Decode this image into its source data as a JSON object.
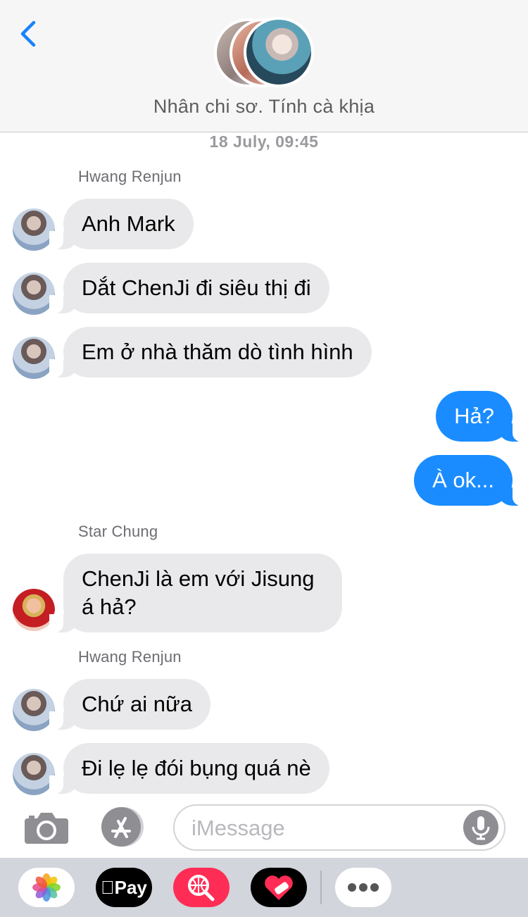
{
  "header": {
    "back_icon": "chevron-left-icon",
    "group_title": "Nhân chi sơ. Tính cà khịa"
  },
  "timestamp": "18 July, 09:45",
  "messages": [
    {
      "sender": "Hwang Renjun",
      "text": "Anh Mark",
      "side": "in"
    },
    {
      "text": "Dắt ChenJi đi siêu thị đi",
      "side": "in"
    },
    {
      "text": "Em ở nhà thăm dò tình hình",
      "side": "in"
    },
    {
      "text": "Hả?",
      "side": "out"
    },
    {
      "text": "À ok...",
      "side": "out"
    },
    {
      "sender": "Star Chung",
      "text": "ChenJi là em với Jisung á hả?",
      "side": "in"
    },
    {
      "sender": "Hwang Renjun",
      "text": "Chứ ai nữa",
      "side": "in"
    },
    {
      "text": "Đi lẹ lẹ đói bụng quá nè",
      "side": "in"
    }
  ],
  "input": {
    "placeholder": "iMessage",
    "value": ""
  },
  "apps": {
    "apple_pay_label": "Pay",
    "icons": [
      "camera-icon",
      "app-store-icon",
      "microphone-icon",
      "photos-icon",
      "apple-pay-icon",
      "image-search-icon",
      "stickers-icon",
      "more-icon"
    ]
  },
  "colors": {
    "outgoing_bubble": "#1a8cff",
    "incoming_bubble": "#e9e9eb",
    "accent": "#1a82fb",
    "search_app": "#ff2d55"
  }
}
